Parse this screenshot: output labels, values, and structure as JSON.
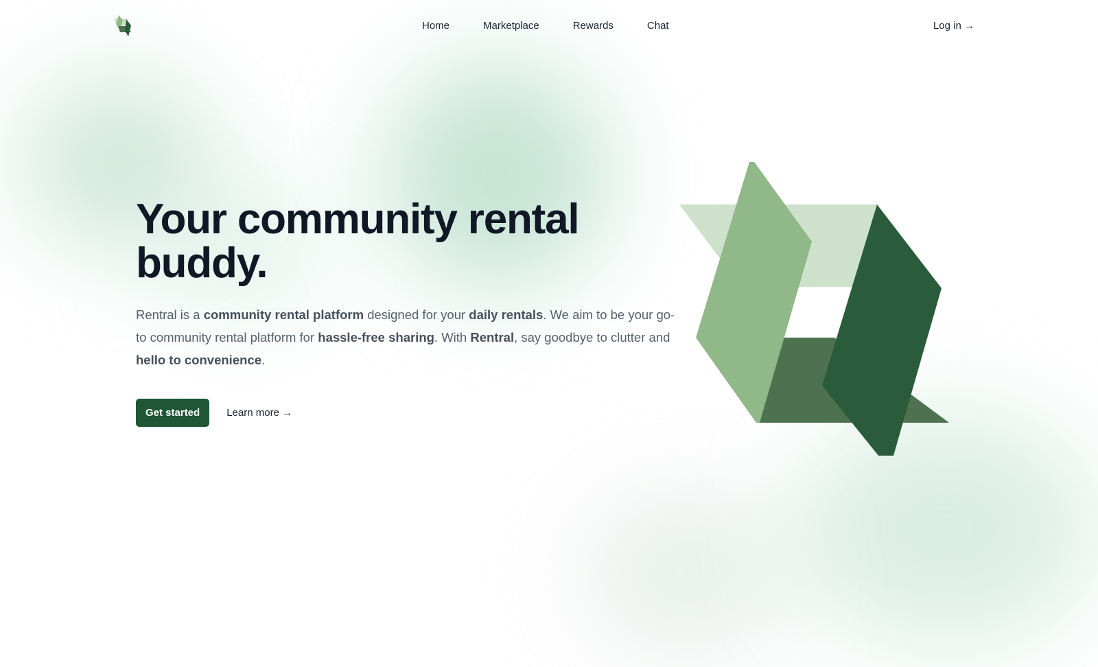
{
  "nav": {
    "logo_icon": "rentral-logo-icon",
    "links": [
      {
        "label": "Home"
      },
      {
        "label": "Marketplace"
      },
      {
        "label": "Rewards"
      },
      {
        "label": "Chat"
      }
    ],
    "login_label": "Log in →"
  },
  "hero": {
    "title": "Your community rental buddy.",
    "description": {
      "t1": "Rentral is a ",
      "b1": "community rental platform",
      "t2": " designed for your ",
      "b2": "daily rentals",
      "t3": ". We aim to be your go-to community rental platform for ",
      "b3": "hassle-free sharing",
      "t4": ". With ",
      "b4": "Rentral",
      "t5": ", say goodbye to clutter and ",
      "b5": "hello to convenience",
      "t6": "."
    },
    "primary_button": "Get started",
    "secondary_link": "Learn more →",
    "illustration": "rentral-logo-illustration"
  },
  "colors": {
    "brand_dark": "#1f5634",
    "brand_mid": "#2a5c3b",
    "brand_light": "#90b889",
    "brand_pale": "#cde1cb",
    "brand_shadow": "#4e7150",
    "heading": "#101826",
    "body_text": "#56606c"
  }
}
